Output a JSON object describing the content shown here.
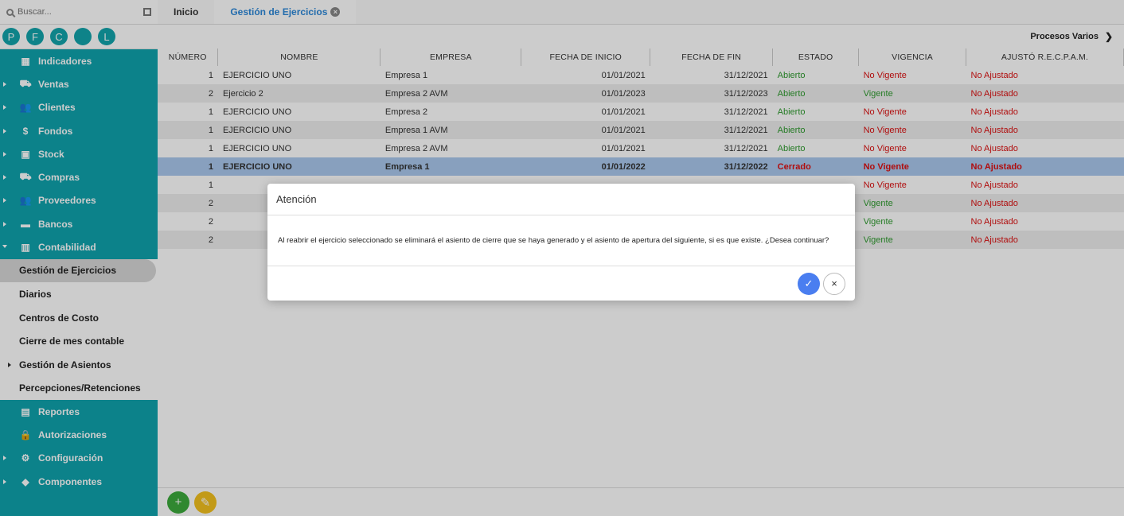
{
  "search": {
    "placeholder": "Buscar..."
  },
  "badges": [
    "P",
    "F",
    "C",
    "",
    "L"
  ],
  "menu_top": [
    {
      "label": "Indicadores",
      "icon": "dashboard-icon",
      "glyph": "▦",
      "arrow": false
    },
    {
      "label": "Ventas",
      "icon": "cart-icon",
      "glyph": "⛟",
      "arrow": true
    },
    {
      "label": "Clientes",
      "icon": "people-icon",
      "glyph": "👥",
      "arrow": true
    },
    {
      "label": "Fondos",
      "icon": "dollar-icon",
      "glyph": "$",
      "arrow": true
    },
    {
      "label": "Stock",
      "icon": "box-icon",
      "glyph": "▣",
      "arrow": true
    },
    {
      "label": "Compras",
      "icon": "basket-icon",
      "glyph": "⛟",
      "arrow": true
    },
    {
      "label": "Proveedores",
      "icon": "people-icon",
      "glyph": "👥",
      "arrow": true
    },
    {
      "label": "Bancos",
      "icon": "bank-icon",
      "glyph": "▬",
      "arrow": true
    },
    {
      "label": "Contabilidad",
      "icon": "book-icon",
      "glyph": "▥",
      "arrow": "down"
    }
  ],
  "submenu": [
    {
      "label": "Gestión de Ejercicios",
      "active": true,
      "arrow": false
    },
    {
      "label": "Diarios",
      "active": false,
      "arrow": false
    },
    {
      "label": "Centros de Costo",
      "active": false,
      "arrow": false
    },
    {
      "label": "Cierre de mes contable",
      "active": false,
      "arrow": false
    },
    {
      "label": "Gestión de Asientos",
      "active": false,
      "arrow": true
    },
    {
      "label": "Percepciones/Retenciones",
      "active": false,
      "arrow": false
    }
  ],
  "menu_bottom": [
    {
      "label": "Reportes",
      "icon": "report-icon",
      "glyph": "▤",
      "arrow": false
    },
    {
      "label": "Autorizaciones",
      "icon": "lock-icon",
      "glyph": "🔒",
      "arrow": false
    },
    {
      "label": "Configuración",
      "icon": "gear-icon",
      "glyph": "⚙",
      "arrow": true
    },
    {
      "label": "Componentes",
      "icon": "tag-icon",
      "glyph": "◆",
      "arrow": true
    }
  ],
  "tabs": [
    {
      "label": "Inicio",
      "active": false
    },
    {
      "label": "Gestión de Ejercicios",
      "active": true
    }
  ],
  "toolbar": {
    "procesos": "Procesos Varios"
  },
  "table": {
    "headers": [
      "NÚMERO",
      "NOMBRE",
      "EMPRESA",
      "FECHA DE INICIO",
      "FECHA DE FIN",
      "ESTADO",
      "VIGENCIA",
      "AJUSTÓ R.E.C.P.A.M."
    ],
    "rows": [
      {
        "numero": "1",
        "nombre": "EJERCICIO UNO",
        "empresa": "Empresa 1",
        "inicio": "01/01/2021",
        "fin": "31/12/2021",
        "estado": "Abierto",
        "vigencia": "No Vigente",
        "ajusto": "No Ajustado",
        "selected": false
      },
      {
        "numero": "2",
        "nombre": "Ejercicio 2",
        "empresa": "Empresa 2 AVM",
        "inicio": "01/01/2023",
        "fin": "31/12/2023",
        "estado": "Abierto",
        "vigencia": "Vigente",
        "ajusto": "No Ajustado",
        "selected": false
      },
      {
        "numero": "1",
        "nombre": "EJERCICIO UNO",
        "empresa": "Empresa 2",
        "inicio": "01/01/2021",
        "fin": "31/12/2021",
        "estado": "Abierto",
        "vigencia": "No Vigente",
        "ajusto": "No Ajustado",
        "selected": false
      },
      {
        "numero": "1",
        "nombre": "EJERCICIO UNO",
        "empresa": "Empresa 1 AVM",
        "inicio": "01/01/2021",
        "fin": "31/12/2021",
        "estado": "Abierto",
        "vigencia": "No Vigente",
        "ajusto": "No Ajustado",
        "selected": false
      },
      {
        "numero": "1",
        "nombre": "EJERCICIO UNO",
        "empresa": "Empresa 2 AVM",
        "inicio": "01/01/2021",
        "fin": "31/12/2021",
        "estado": "Abierto",
        "vigencia": "No Vigente",
        "ajusto": "No Ajustado",
        "selected": false
      },
      {
        "numero": "1",
        "nombre": "EJERCICIO UNO",
        "empresa": "Empresa 1",
        "inicio": "01/01/2022",
        "fin": "31/12/2022",
        "estado": "Cerrado",
        "vigencia": "No Vigente",
        "ajusto": "No Ajustado",
        "selected": true
      },
      {
        "numero": "1",
        "nombre": "",
        "empresa": "",
        "inicio": "",
        "fin": "",
        "estado": "",
        "vigencia": "No Vigente",
        "ajusto": "No Ajustado",
        "selected": false
      },
      {
        "numero": "2",
        "nombre": "",
        "empresa": "",
        "inicio": "",
        "fin": "",
        "estado": "",
        "vigencia": "Vigente",
        "ajusto": "No Ajustado",
        "selected": false
      },
      {
        "numero": "2",
        "nombre": "",
        "empresa": "",
        "inicio": "",
        "fin": "",
        "estado": "",
        "vigencia": "Vigente",
        "ajusto": "No Ajustado",
        "selected": false
      },
      {
        "numero": "2",
        "nombre": "",
        "empresa": "",
        "inicio": "",
        "fin": "",
        "estado": "",
        "vigencia": "Vigente",
        "ajusto": "No Ajustado",
        "selected": false
      }
    ]
  },
  "fabs": {
    "add": "+",
    "edit": "✎"
  },
  "dialog": {
    "title": "Atención",
    "message": "Al reabrir el ejercicio seleccionado se eliminará el asiento de cierre que se haya generado y el asiento de apertura del siguiente, si es que existe. ¿Desea continuar?",
    "ok": "✓",
    "cancel": "×"
  },
  "colors": {
    "sidebar": "#0fa3ad",
    "accent": "#2c88d9",
    "green": "#2e9a2e",
    "red": "#dd1111",
    "confirm": "#4a7ef0"
  }
}
